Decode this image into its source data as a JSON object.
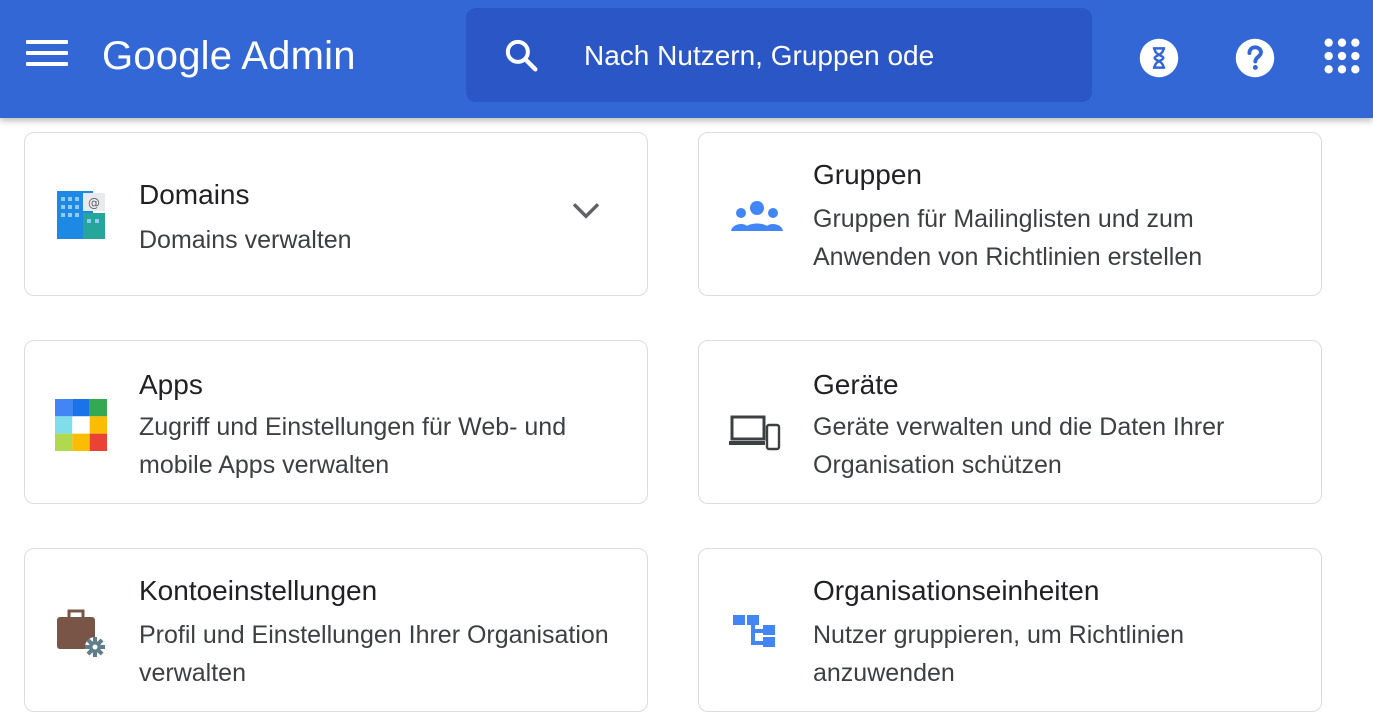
{
  "header": {
    "brand_google": "Google",
    "brand_admin": "Admin",
    "search_placeholder": "Nach Nutzern, Gruppen ode",
    "icons": [
      "menu-icon",
      "search-icon",
      "hourglass-icon",
      "help-icon",
      "apps-grid-icon"
    ],
    "background_color": "#3367d6"
  },
  "cards": [
    {
      "title": "Domains",
      "desc": "Domains verwalten",
      "icon": "domains-icon"
    },
    {
      "title": "Gruppen",
      "desc": "Gruppen für Mailinglisten und zum Anwenden von Richtlinien erstellen",
      "icon": "groups-icon"
    },
    {
      "title": "Apps",
      "desc": "Zugriff und Einstellungen für Web- und mobile Apps verwalten",
      "icon": "apps-icon"
    },
    {
      "title": "Geräte",
      "desc": "Geräte verwalten und die Daten Ihrer Organisation schützen",
      "icon": "devices-icon"
    },
    {
      "title": "Kontoeinstellungen",
      "desc": "Profil und Einstellungen Ihrer Organisation verwalten",
      "icon": "account-settings-icon"
    },
    {
      "title": "Organisationseinheiten",
      "desc": "Nutzer gruppieren, um Richtlinien anzuwenden",
      "icon": "org-units-icon"
    }
  ]
}
